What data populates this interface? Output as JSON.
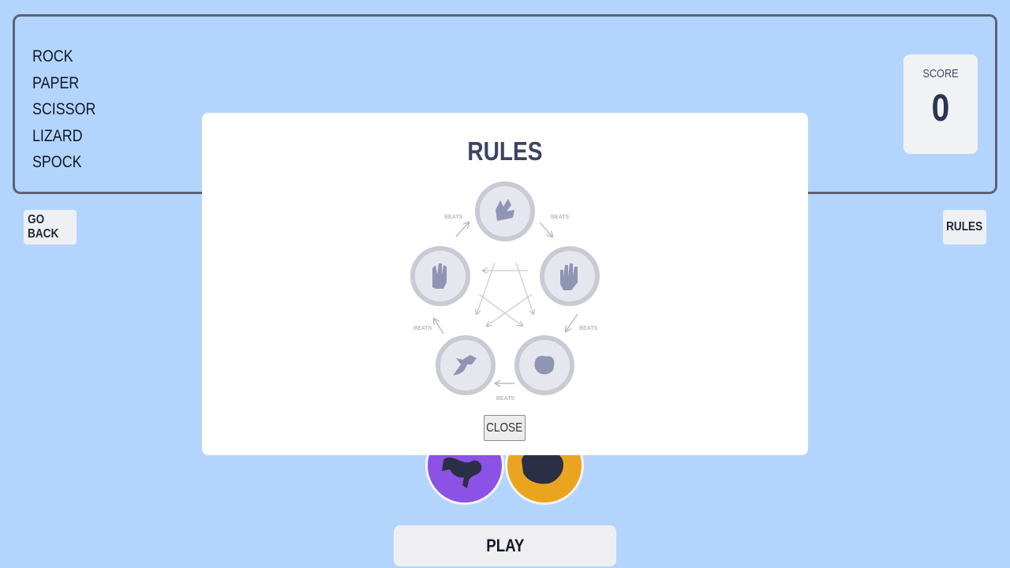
{
  "header": {
    "choices": [
      "ROCK",
      "PAPER",
      "SCISSOR",
      "LIZARD",
      "SPOCK"
    ],
    "score_label": "SCORE",
    "score_value": "0"
  },
  "buttons": {
    "go_back": "GO BACK",
    "rules": "RULES",
    "play": "PLAY"
  },
  "modal": {
    "title": "RULES",
    "close": "CLOSE",
    "beats_label": "BEATS"
  },
  "colors": {
    "background": "#b3d5fd",
    "lizard": "#8c52e5",
    "rock": "#eba420",
    "title": "#3a4462"
  }
}
